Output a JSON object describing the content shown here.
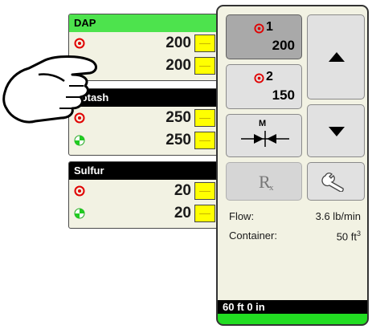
{
  "products": [
    {
      "name": "DAP",
      "header_color": "#4de34d",
      "header_text_color": "#000000",
      "rates": [
        "200",
        "200"
      ]
    },
    {
      "name": "Potash",
      "header_color": "#000000",
      "header_text_color": "#ffffff",
      "rates": [
        "250",
        "250"
      ]
    },
    {
      "name": "Sulfur",
      "header_color": "#000000",
      "header_text_color": "#ffffff",
      "rates": [
        "20",
        "20"
      ]
    }
  ],
  "panel": {
    "preset1": {
      "number": "1",
      "value": "200"
    },
    "preset2": {
      "number": "2",
      "value": "150"
    },
    "manual_label": "M",
    "rx_label": "R",
    "flow_label": "Flow:",
    "flow_value": "3.6 lb/min",
    "container_label": "Container:",
    "container_value": "50 ft",
    "container_unit_sup": "3",
    "distance": "60 ft 0 in"
  },
  "colors": {
    "target": "#e00000",
    "applied": "#22cc22",
    "highlight": "#ffff00"
  },
  "icons": [
    "target-icon",
    "applied-rate-icon",
    "up-arrow-icon",
    "down-arrow-icon",
    "manual-rate-icon",
    "prescription-icon",
    "wrench-icon",
    "pointing-hand-icon"
  ]
}
